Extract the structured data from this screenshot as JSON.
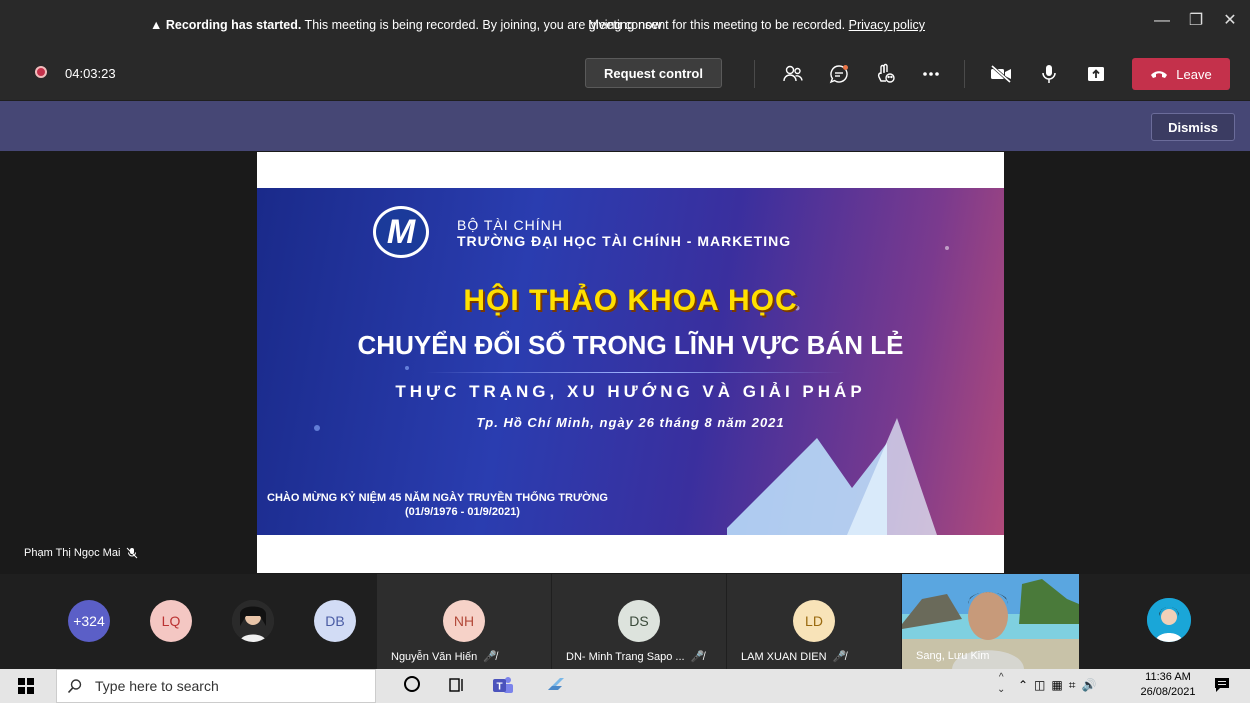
{
  "window": {
    "title": "Meeting now",
    "controls": [
      "minimize",
      "restore",
      "close"
    ]
  },
  "toolbar": {
    "timer": "04:03:23",
    "request_control_label": "Request control",
    "leave_label": "Leave",
    "icons": [
      "participants-icon",
      "chat-icon",
      "reactions-icon",
      "more-icon",
      "camera-off-icon",
      "mic-icon",
      "share-icon"
    ]
  },
  "banner": {
    "bold": "Recording has started.",
    "text": " This meeting is being recorded. By joining, you are giving consent for this meeting to be recorded. ",
    "link": "Privacy policy",
    "dismiss_label": "Dismiss"
  },
  "slide": {
    "line1": "BỘ TÀI CHÍNH",
    "line2": "TRƯỜNG ĐẠI HỌC TÀI CHÍNH - MARKETING",
    "headline": "HỘI THẢO KHOA HỌC",
    "subhead": "CHUYỂN ĐỔI SỐ TRONG LĨNH VỰC BÁN LẺ",
    "tagline": "THỰC TRẠNG, XU HƯỚNG VÀ GIẢI PHÁP",
    "date_line": "Tp. Hồ Chí Minh, ngày 26 tháng 8 năm 2021",
    "anniversary": "CHÀO MỪNG KỶ NIỆM 45 NĂM NGÀY TRUYỀN THỐNG TRƯỜNG",
    "anniversary_dates": "(01/9/1976 - 01/9/2021)"
  },
  "presenter": {
    "name": "Phạm Thị Ngọc Mai"
  },
  "participants": {
    "overflow": "+324",
    "avatars": [
      "LQ",
      "DB",
      "NH",
      "DS",
      "LD"
    ],
    "names": [
      "Nguyễn Văn Hiến",
      "DN- Minh Trang Sapo ...",
      "LAM XUAN DIEN",
      "Sang, Lưu Kim"
    ]
  },
  "taskbar": {
    "search_placeholder": "Type here to search",
    "time": "11:36 AM",
    "date": "26/08/2021"
  },
  "colors": {
    "accent": "#464775",
    "leave": "#c4314b",
    "bg": "#1f1f1f"
  }
}
